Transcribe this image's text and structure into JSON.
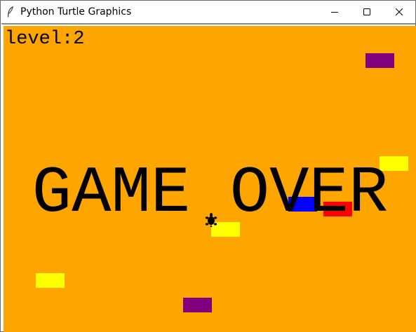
{
  "window": {
    "title": "Python Turtle Graphics",
    "icon": "feather-icon",
    "controls": [
      "minimize-icon",
      "maximize-icon",
      "close-icon"
    ]
  },
  "game": {
    "level_text": "level:2",
    "status_text": "GAME OVER",
    "background_color": "#ffa500",
    "player": {
      "shape": "turtle-icon",
      "color": "#000000"
    },
    "obstacles": [
      {
        "color": "purple"
      },
      {
        "color": "yellow"
      },
      {
        "color": "blue"
      },
      {
        "color": "red"
      },
      {
        "color": "yellow"
      },
      {
        "color": "yellow"
      },
      {
        "color": "purple"
      }
    ]
  }
}
